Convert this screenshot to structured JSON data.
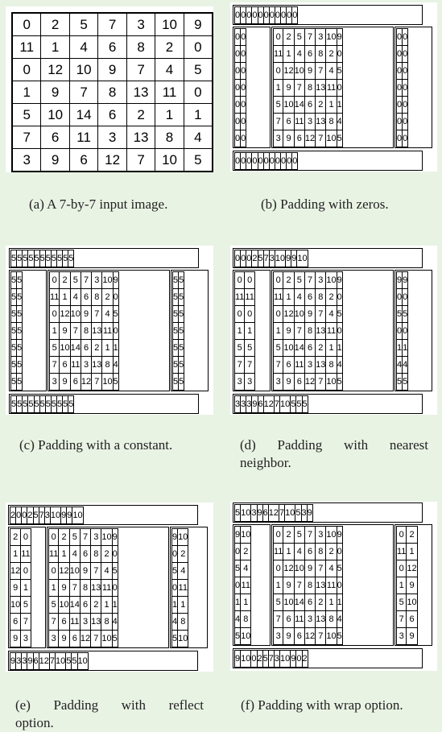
{
  "panels": [
    {
      "id": "a",
      "caption": "(a) A 7-by-7 input image.",
      "caption_line2": "",
      "rows": [
        [
          "0",
          "2",
          "5",
          "7",
          "3",
          "10",
          "9"
        ],
        [
          "11",
          "1",
          "4",
          "6",
          "8",
          "2",
          "0"
        ],
        [
          "0",
          "12",
          "10",
          "9",
          "7",
          "4",
          "5"
        ],
        [
          "1",
          "9",
          "7",
          "8",
          "13",
          "11",
          "0"
        ],
        [
          "5",
          "10",
          "14",
          "6",
          "2",
          "1",
          "1"
        ],
        [
          "7",
          "6",
          "11",
          "3",
          "13",
          "8",
          "4"
        ],
        [
          "3",
          "9",
          "6",
          "12",
          "7",
          "10",
          "5"
        ]
      ]
    },
    {
      "id": "b",
      "caption": "(b) Padding with zeros.",
      "caption_line2": "",
      "rows": [
        [
          "0",
          "0",
          "0",
          "0",
          "0",
          "0",
          "0",
          "0",
          "0",
          "0",
          "0"
        ],
        [
          "0",
          "0",
          "0",
          "2",
          "5",
          "7",
          "3",
          "10",
          "9",
          "0",
          "0"
        ],
        [
          "0",
          "0",
          "11",
          "1",
          "4",
          "6",
          "8",
          "2",
          "0",
          "0",
          "0"
        ],
        [
          "0",
          "0",
          "0",
          "12",
          "10",
          "9",
          "7",
          "4",
          "5",
          "0",
          "0"
        ],
        [
          "0",
          "0",
          "1",
          "9",
          "7",
          "8",
          "13",
          "11",
          "0",
          "0",
          "0"
        ],
        [
          "0",
          "0",
          "5",
          "10",
          "14",
          "6",
          "2",
          "1",
          "1",
          "0",
          "0"
        ],
        [
          "0",
          "0",
          "7",
          "6",
          "11",
          "3",
          "13",
          "8",
          "4",
          "0",
          "0"
        ],
        [
          "0",
          "0",
          "3",
          "9",
          "6",
          "12",
          "7",
          "10",
          "5",
          "0",
          "0"
        ],
        [
          "0",
          "0",
          "0",
          "0",
          "0",
          "0",
          "0",
          "0",
          "0",
          "0",
          "0"
        ]
      ]
    },
    {
      "id": "c",
      "caption": "(c) Padding with a constant.",
      "caption_line2": "",
      "rows": [
        [
          "5",
          "5",
          "5",
          "5",
          "5",
          "5",
          "5",
          "5",
          "5",
          "5",
          "5"
        ],
        [
          "5",
          "5",
          "0",
          "2",
          "5",
          "7",
          "3",
          "10",
          "9",
          "5",
          "5"
        ],
        [
          "5",
          "5",
          "11",
          "1",
          "4",
          "6",
          "8",
          "2",
          "0",
          "5",
          "5"
        ],
        [
          "5",
          "5",
          "0",
          "12",
          "10",
          "9",
          "7",
          "4",
          "5",
          "5",
          "5"
        ],
        [
          "5",
          "5",
          "1",
          "9",
          "7",
          "8",
          "13",
          "11",
          "0",
          "5",
          "5"
        ],
        [
          "5",
          "5",
          "5",
          "10",
          "14",
          "6",
          "2",
          "1",
          "1",
          "5",
          "5"
        ],
        [
          "5",
          "5",
          "7",
          "6",
          "11",
          "3",
          "13",
          "8",
          "4",
          "5",
          "5"
        ],
        [
          "5",
          "5",
          "3",
          "9",
          "6",
          "12",
          "7",
          "10",
          "5",
          "5",
          "5"
        ],
        [
          "5",
          "5",
          "5",
          "5",
          "5",
          "5",
          "5",
          "5",
          "5",
          "5",
          "5"
        ]
      ]
    },
    {
      "id": "d",
      "caption": "(d) Padding with nearest",
      "caption_line2": "neighbor.",
      "rows": [
        [
          "0",
          "0",
          "0",
          "2",
          "5",
          "7",
          "3",
          "10",
          "9",
          "9",
          "10"
        ],
        [
          "0",
          "0",
          "0",
          "2",
          "5",
          "7",
          "3",
          "10",
          "9",
          "9",
          "9"
        ],
        [
          "11",
          "11",
          "11",
          "1",
          "4",
          "6",
          "8",
          "2",
          "0",
          "0",
          "0"
        ],
        [
          "0",
          "0",
          "0",
          "12",
          "10",
          "9",
          "7",
          "4",
          "5",
          "5",
          "5"
        ],
        [
          "1",
          "1",
          "1",
          "9",
          "7",
          "8",
          "13",
          "11",
          "0",
          "0",
          "0"
        ],
        [
          "5",
          "5",
          "5",
          "10",
          "14",
          "6",
          "2",
          "1",
          "1",
          "1",
          "1"
        ],
        [
          "7",
          "7",
          "7",
          "6",
          "11",
          "3",
          "13",
          "8",
          "4",
          "4",
          "4"
        ],
        [
          "3",
          "3",
          "3",
          "9",
          "6",
          "12",
          "7",
          "10",
          "5",
          "5",
          "5"
        ],
        [
          "3",
          "3",
          "3",
          "9",
          "6",
          "12",
          "7",
          "10",
          "5",
          "5",
          "5"
        ]
      ]
    },
    {
      "id": "e",
      "caption": "(e) Padding with reflect",
      "caption_line2": "option.",
      "rows": [
        [
          "2",
          "0",
          "0",
          "2",
          "5",
          "7",
          "3",
          "10",
          "9",
          "9",
          "10"
        ],
        [
          "2",
          "0",
          "0",
          "2",
          "5",
          "7",
          "3",
          "10",
          "9",
          "9",
          "10"
        ],
        [
          "1",
          "11",
          "11",
          "1",
          "4",
          "6",
          "8",
          "2",
          "0",
          "0",
          "2"
        ],
        [
          "12",
          "0",
          "0",
          "12",
          "10",
          "9",
          "7",
          "4",
          "5",
          "5",
          "4"
        ],
        [
          "9",
          "1",
          "1",
          "9",
          "7",
          "8",
          "13",
          "11",
          "0",
          "0",
          "11"
        ],
        [
          "10",
          "5",
          "5",
          "10",
          "14",
          "6",
          "2",
          "1",
          "1",
          "1",
          "1"
        ],
        [
          "6",
          "7",
          "7",
          "6",
          "11",
          "3",
          "13",
          "8",
          "4",
          "4",
          "8"
        ],
        [
          "9",
          "3",
          "3",
          "9",
          "6",
          "12",
          "7",
          "10",
          "5",
          "5",
          "10"
        ],
        [
          "9",
          "3",
          "3",
          "9",
          "6",
          "12",
          "7",
          "10",
          "5",
          "5",
          "10"
        ]
      ]
    },
    {
      "id": "f",
      "caption": "(f) Padding with wrap option.",
      "caption_line2": "",
      "rows": [
        [
          "5",
          "10",
          "3",
          "9",
          "6",
          "12",
          "7",
          "10",
          "5",
          "3",
          "9"
        ],
        [
          "9",
          "10",
          "0",
          "2",
          "5",
          "7",
          "3",
          "10",
          "9",
          "0",
          "2"
        ],
        [
          "0",
          "2",
          "11",
          "1",
          "4",
          "6",
          "8",
          "2",
          "0",
          "11",
          "1"
        ],
        [
          "5",
          "4",
          "0",
          "12",
          "10",
          "9",
          "7",
          "4",
          "5",
          "0",
          "12"
        ],
        [
          "0",
          "11",
          "1",
          "9",
          "7",
          "8",
          "13",
          "11",
          "0",
          "1",
          "9"
        ],
        [
          "1",
          "1",
          "5",
          "10",
          "14",
          "6",
          "2",
          "1",
          "1",
          "5",
          "10"
        ],
        [
          "4",
          "8",
          "7",
          "6",
          "11",
          "3",
          "13",
          "8",
          "4",
          "7",
          "6"
        ],
        [
          "5",
          "10",
          "3",
          "9",
          "6",
          "12",
          "7",
          "10",
          "5",
          "3",
          "9"
        ],
        [
          "9",
          "10",
          "0",
          "2",
          "5",
          "7",
          "3",
          "10",
          "9",
          "0",
          "2"
        ]
      ]
    }
  ]
}
